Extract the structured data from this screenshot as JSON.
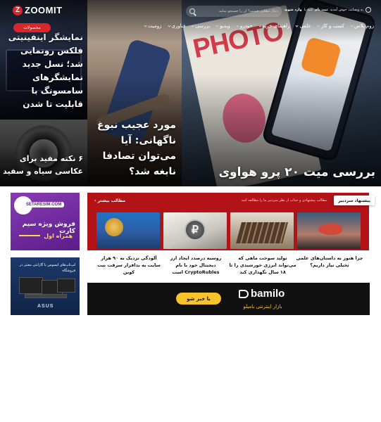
{
  "header": {
    "logo_text": "ZOOMIT",
    "logo_mark": "Z",
    "search_placeholder": "دنبال مطلبی هستید؟ آن را جستجو نمایید",
    "login_prefix": "به وبسایت خوش آمدید",
    "login_register": "ثبت نام",
    "login_connector": "کنید یا",
    "login_enter": "وارد شوید",
    "products_button": "محصولات",
    "nav": [
      {
        "label": "زومیت",
        "has_dropdown": true
      },
      {
        "label": "فناوری",
        "has_dropdown": true
      },
      {
        "label": "بررسی",
        "has_dropdown": true
      },
      {
        "label": "ویدیو",
        "has_dropdown": true
      },
      {
        "label": "خودرو",
        "has_dropdown": true
      },
      {
        "label": "راهنمای خرید",
        "has_dropdown": true
      },
      {
        "label": "علمی",
        "has_dropdown": true
      },
      {
        "label": "کسب و کار",
        "has_dropdown": true
      },
      {
        "label": "زوم پلاس",
        "has_dropdown": true
      }
    ]
  },
  "hero": {
    "main_title": "بررسی میت ۲۰ پرو هواوی",
    "mag_title": "PHOTO",
    "skate_title": "مورد عجیب نبوغ ناگهانی: آیا می‌توان تصادفا نابغه شد؟",
    "monitor_title": "نمایشگر اینفینیتی فلکس رونمایی شد؛ نسل جدید نمایشگرهای سامسونگ با قابلیت تا شدن",
    "lens_title": "۶ نکته مفید برای عکاسی سیاه و سفید"
  },
  "editor": {
    "tab_label": "پیشنهاد سردبیر",
    "subtitle": "مطالب پیشنهادی و جذاب از نظر سردبیر ما را مطالعه کنید",
    "more_label": "مطالب بیشتر",
    "more_arrow": "‹",
    "cards": [
      {
        "title": "چرا هنوز به داستان‌های علمی تخیلی نیاز داریم؟"
      },
      {
        "title": "تولید سوخت ماهی که می‌تواند انرژی خورشیدی را تا ۱۸ سال نگهداری کند"
      },
      {
        "title": "روسیه درصدد ایجاد ارز دیجیتال خود با نام CryptoRubles است"
      },
      {
        "title": "آلودگی نزدیک به ۹۰ هزار سایت به بدافزار سرقت بیت کوین"
      }
    ],
    "coin_symbol": "₽"
  },
  "ads": {
    "bamilo_logo": "bamilo",
    "bamilo_tagline": "بازار اینترنتی بامیلو",
    "bamilo_button": "با خبر شو",
    "sim_site": "SETARESIM.COM",
    "sim_title": "فروش ویژه سیم کارت",
    "sim_sub": "همراه اول",
    "asus_text": "لپ‌تاپ‌های ایسوس با گارانتی معتبر در فروشگاه",
    "asus_brand": "ASUS"
  },
  "colors": {
    "brand_red": "#d8262b",
    "editor_red": "#b31217",
    "bamilo_yellow": "#f8c22a"
  }
}
